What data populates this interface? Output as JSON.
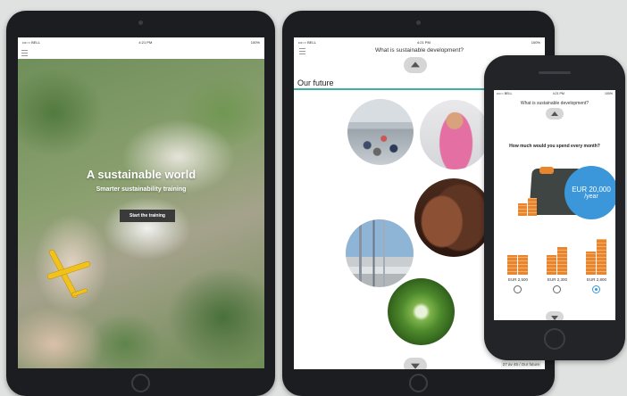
{
  "tablet_left": {
    "status": {
      "carrier": "•••○○ BELL",
      "time": "4:21 PM",
      "battery": "100%"
    },
    "hero": {
      "title": "A sustainable world",
      "subtitle": "Smarter sustainability training",
      "button_label": "Start the training"
    }
  },
  "tablet_right": {
    "status": {
      "carrier": "•••○○ BELL",
      "time": "4:21 PM",
      "battery": "100%"
    },
    "header": {
      "title": "What is sustainable development?"
    },
    "section_label": "Our future",
    "page_counter": "27 av 45 / Our future"
  },
  "phone": {
    "status": {
      "carrier": "•••○○ BELL",
      "time": "4:21 PM",
      "battery": "100%"
    },
    "header": {
      "title": "What is sustainable development?"
    },
    "question": "How much would you spend every month?",
    "amount_bubble": {
      "amount": "EUR 20,000",
      "period": "/year"
    },
    "options": [
      {
        "label": "EUR 2,500",
        "selected": false
      },
      {
        "label": "EUR 2,300",
        "selected": false
      },
      {
        "label": "EUR 2,800",
        "selected": true
      }
    ]
  },
  "colors": {
    "accent_teal": "#3fb1a0",
    "bubble_blue": "#3b97d9",
    "coin_orange": "#e9852f"
  }
}
